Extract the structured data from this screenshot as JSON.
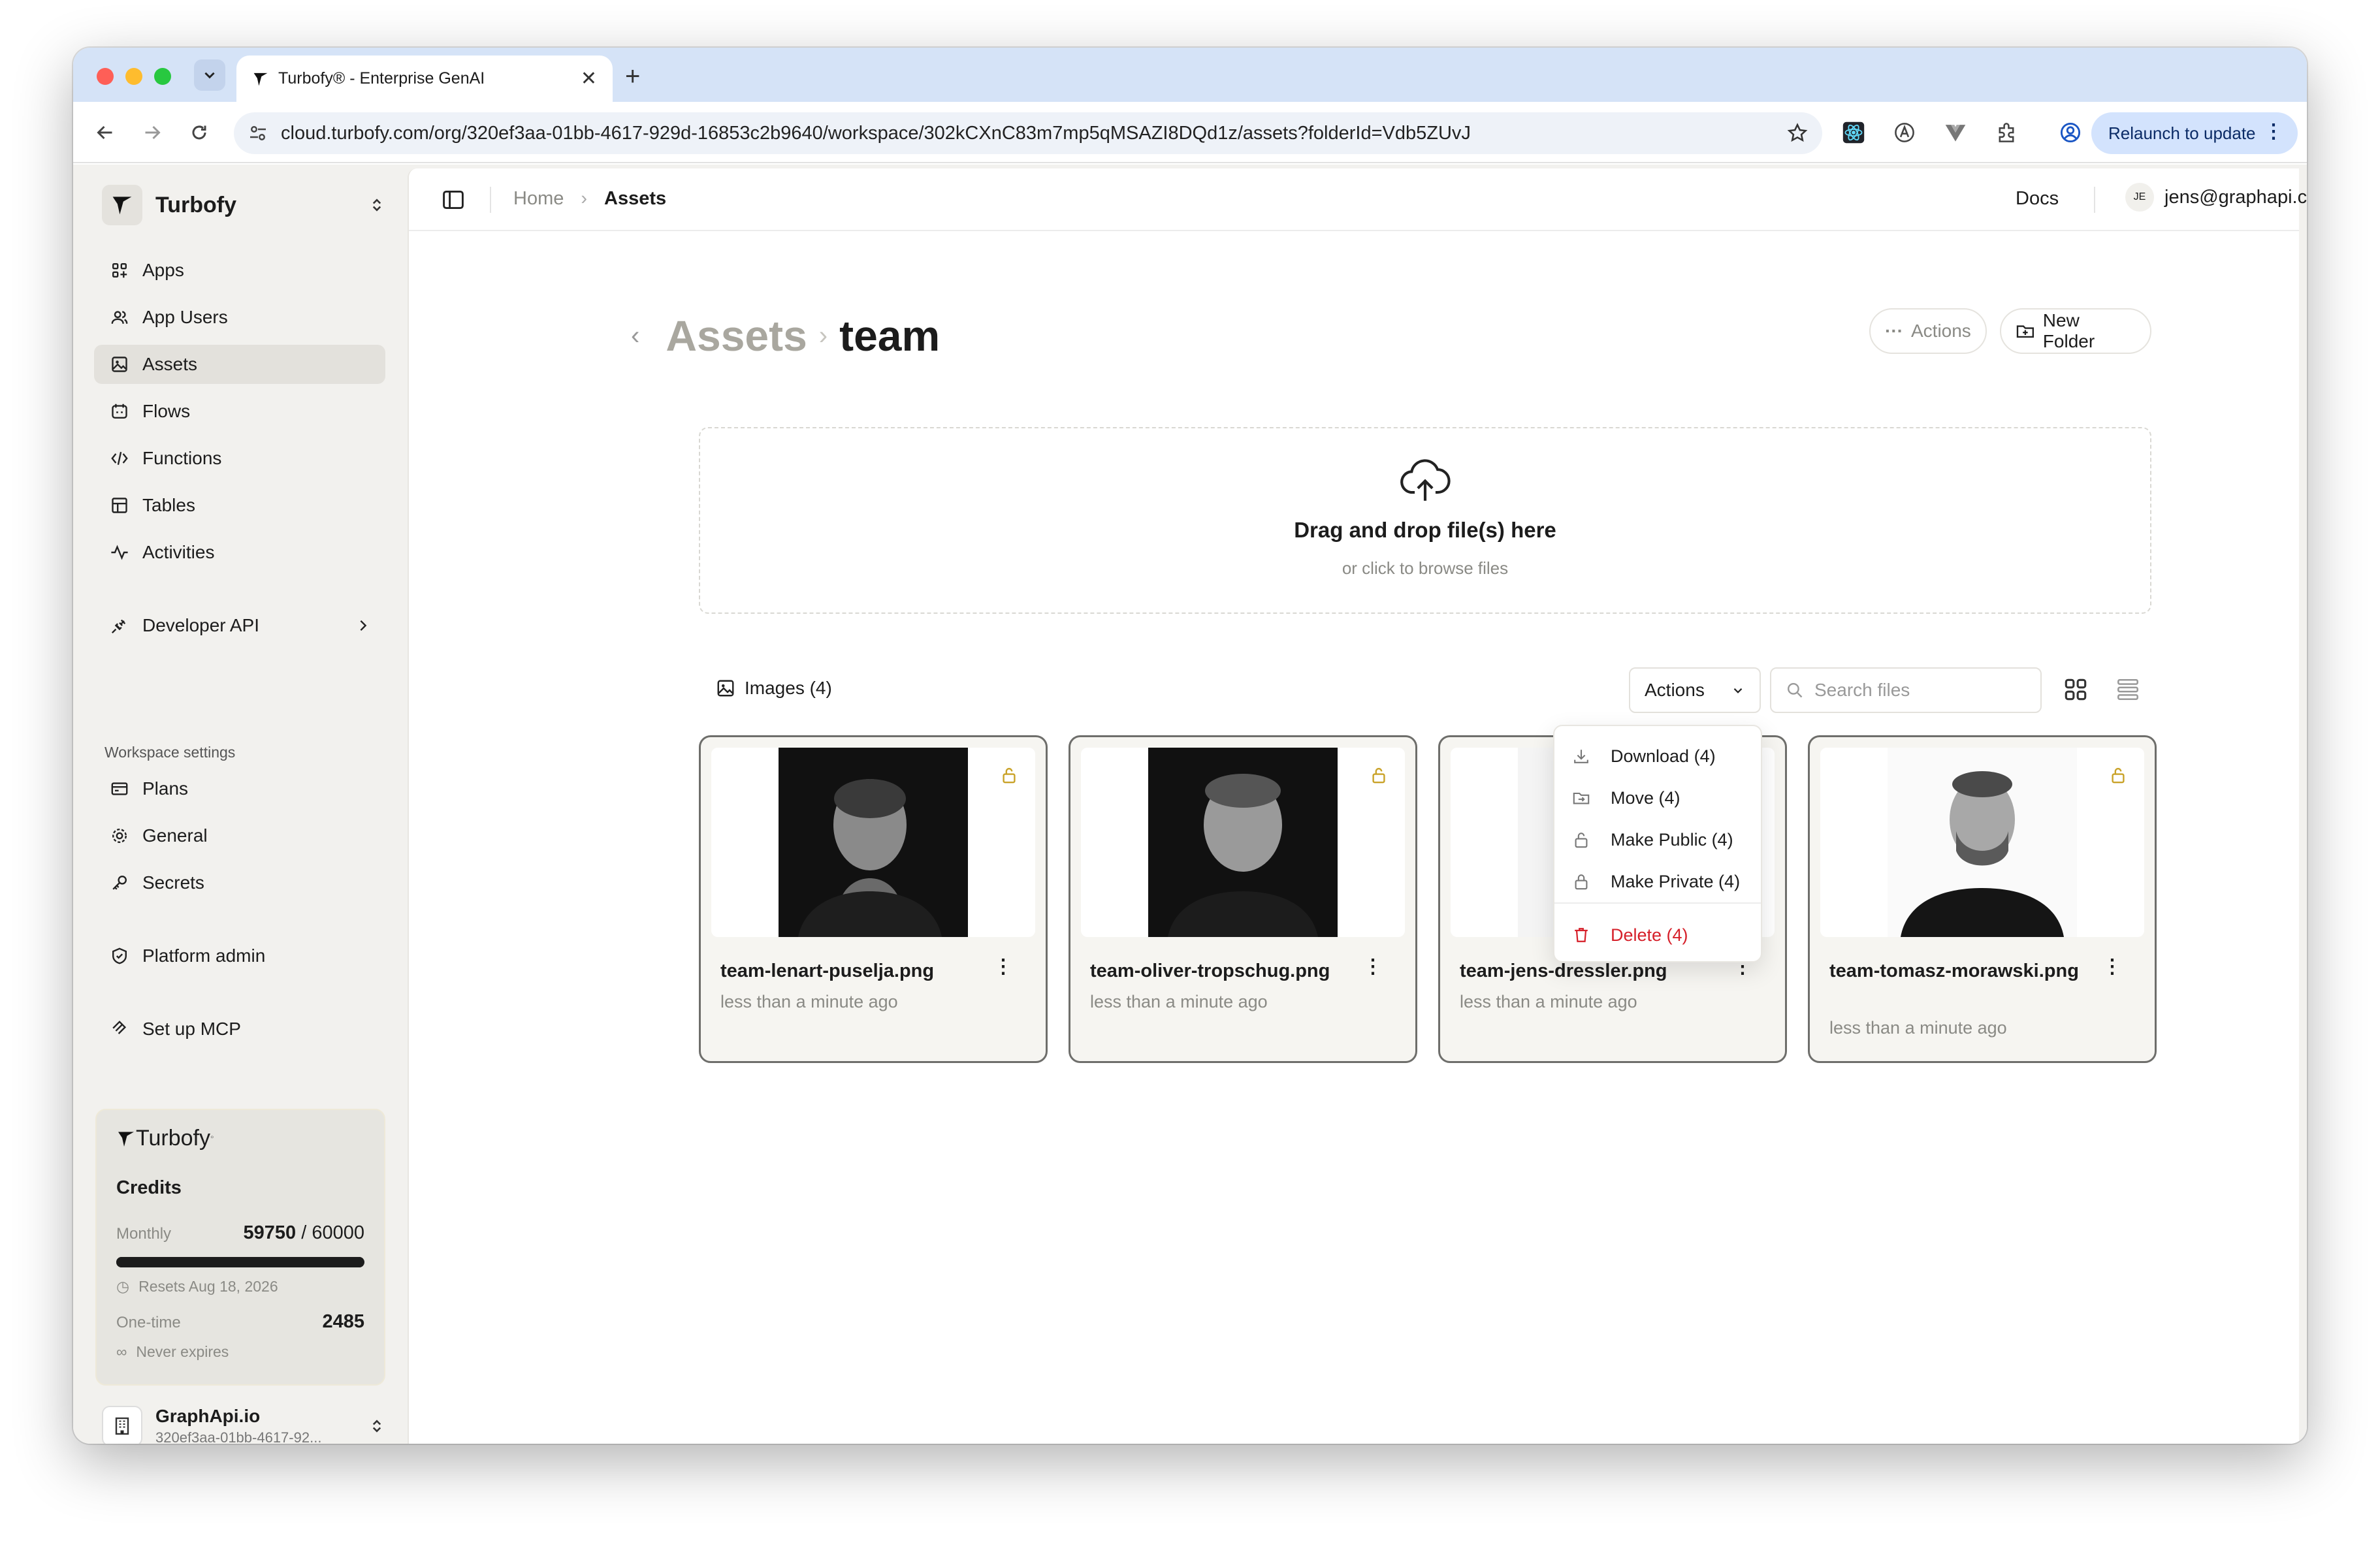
{
  "browser": {
    "tab_title": "Turbofy® - Enterprise GenAI",
    "url": "cloud.turbofy.com/org/320ef3aa-01bb-4617-929d-16853c2b9640/workspace/302kCXnC83m7mp5qMSAZI8DQd1z/assets?folderId=Vdb5ZUvJ",
    "relaunch_label": "Relaunch to update"
  },
  "sidebar": {
    "brand": "Turbofy",
    "nav": [
      {
        "label": "Apps",
        "icon": "apps-icon"
      },
      {
        "label": "App Users",
        "icon": "users-icon"
      },
      {
        "label": "Assets",
        "icon": "image-icon",
        "active": true
      },
      {
        "label": "Flows",
        "icon": "flows-icon"
      },
      {
        "label": "Functions",
        "icon": "code-icon"
      },
      {
        "label": "Tables",
        "icon": "table-icon"
      },
      {
        "label": "Activities",
        "icon": "activity-icon"
      }
    ],
    "developer_api": "Developer API",
    "workspace_settings_heading": "Workspace settings",
    "settings": [
      {
        "label": "Plans",
        "icon": "card-icon"
      },
      {
        "label": "General",
        "icon": "gear-icon"
      },
      {
        "label": "Secrets",
        "icon": "key-icon"
      }
    ],
    "platform_admin": "Platform admin",
    "setup_mcp": "Set up MCP",
    "credits": {
      "brand": "Turbofy",
      "title": "Credits",
      "monthly_label": "Monthly",
      "monthly_used": "59750",
      "monthly_total": "/ 60000",
      "monthly_fraction": 0.9958,
      "resets": "Resets Aug 18, 2026",
      "onetime_label": "One-time",
      "onetime_value": "2485",
      "never_expires": "Never expires"
    },
    "org": {
      "name": "GraphApi.io",
      "id": "320ef3aa-01bb-4617-92..."
    }
  },
  "header": {
    "breadcrumb_home": "Home",
    "breadcrumb_current": "Assets",
    "docs": "Docs",
    "user_initials": "JE",
    "user_email": "jens@graphapi.com"
  },
  "page": {
    "title_parent": "Assets",
    "title_current": "team",
    "actions_label": "Actions",
    "new_folder_label": "New Folder",
    "dropzone_title": "Drag and drop file(s) here",
    "dropzone_sub": "or click to browse files",
    "images_count_label": "Images (4)",
    "actions_dropdown_label": "Actions",
    "search_placeholder": "Search files"
  },
  "files": [
    {
      "name": "team-lenart-puselja.png",
      "time": "less than a minute ago"
    },
    {
      "name": "team-oliver-tropschug.png",
      "time": "less than a minute ago"
    },
    {
      "name": "team-jens-dressler.png",
      "time": "less than a minute ago"
    },
    {
      "name": "team-tomasz-morawski.png",
      "time": "less than a minute ago"
    }
  ],
  "actions_menu": [
    {
      "label": "Download (4)",
      "icon": "download-icon"
    },
    {
      "label": "Move (4)",
      "icon": "move-icon"
    },
    {
      "label": "Make Public (4)",
      "icon": "unlock-icon"
    },
    {
      "label": "Make Private (4)",
      "icon": "lock-icon"
    },
    {
      "label": "Delete (4)",
      "icon": "trash-icon",
      "danger": true
    }
  ],
  "colors": {
    "accent_lock": "#c9a227",
    "danger": "#d6202a",
    "sidebar_bg": "#f2f1ee"
  }
}
